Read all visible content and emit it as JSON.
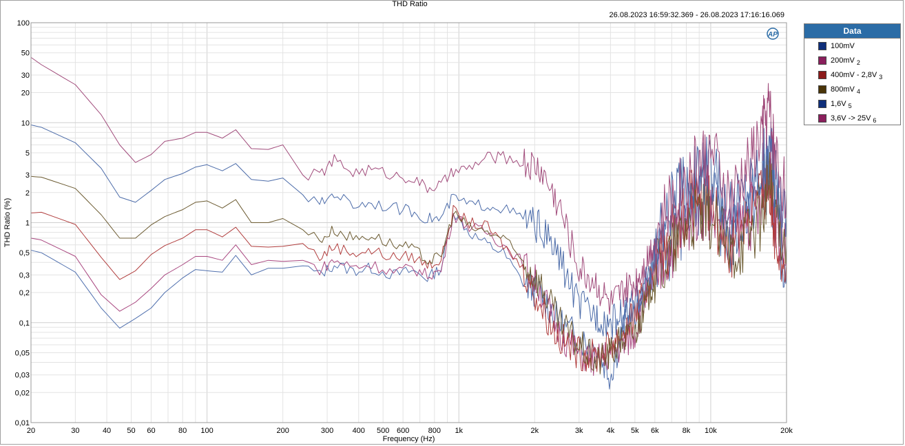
{
  "window": {
    "title": "THD Ratio",
    "timestamp": "26.08.2023 16:59:32.369 - 26.08.2023 17:16:16.069"
  },
  "legend": {
    "header": "Data",
    "items": [
      {
        "label": "100mV",
        "sub": "",
        "color": "#0f2f7a"
      },
      {
        "label": "200mV",
        "sub": "2",
        "color": "#8a1f5c"
      },
      {
        "label": "400mV - 2,8V",
        "sub": "3",
        "color": "#8b1a1a"
      },
      {
        "label": "800mV",
        "sub": "4",
        "color": "#4a3408"
      },
      {
        "label": "1,6V",
        "sub": "5",
        "color": "#0f2f7a"
      },
      {
        "label": "3,6V -> 25V",
        "sub": "6",
        "color": "#8a1f5c"
      }
    ]
  },
  "colors": {
    "grid": "#d9d9d9",
    "series_trace_1": "#4a6aa8",
    "series_trace_2": "#a04a7a",
    "series_trace_3": "#a03a3a",
    "series_trace_4": "#6b5a30"
  },
  "icons": {
    "logo": "ap-logo-icon"
  },
  "chart_data": {
    "type": "line",
    "title": "THD Ratio",
    "xlabel": "Frequency (Hz)",
    "ylabel": "THD Ratio (%)",
    "xscale": "log",
    "yscale": "log",
    "xlim": [
      20,
      20000
    ],
    "ylim": [
      0.01,
      100
    ],
    "grid": true,
    "legend_position": "right",
    "x_ticks": [
      {
        "v": 20,
        "label": "20"
      },
      {
        "v": 30,
        "label": "30"
      },
      {
        "v": 40,
        "label": "40"
      },
      {
        "v": 50,
        "label": "50"
      },
      {
        "v": 60,
        "label": "60"
      },
      {
        "v": 80,
        "label": "80"
      },
      {
        "v": 100,
        "label": "100"
      },
      {
        "v": 200,
        "label": "200"
      },
      {
        "v": 300,
        "label": "300"
      },
      {
        "v": 400,
        "label": "400"
      },
      {
        "v": 500,
        "label": "500"
      },
      {
        "v": 600,
        "label": "600"
      },
      {
        "v": 800,
        "label": "800"
      },
      {
        "v": 1000,
        "label": "1k"
      },
      {
        "v": 2000,
        "label": "2k"
      },
      {
        "v": 3000,
        "label": "3k"
      },
      {
        "v": 4000,
        "label": "4k"
      },
      {
        "v": 5000,
        "label": "5k"
      },
      {
        "v": 6000,
        "label": "6k"
      },
      {
        "v": 8000,
        "label": "8k"
      },
      {
        "v": 10000,
        "label": "10k"
      },
      {
        "v": 20000,
        "label": "20k"
      }
    ],
    "y_ticks": [
      {
        "v": 100,
        "label": "100"
      },
      {
        "v": 50,
        "label": "50"
      },
      {
        "v": 30,
        "label": "30"
      },
      {
        "v": 20,
        "label": "20"
      },
      {
        "v": 10,
        "label": "10"
      },
      {
        "v": 5,
        "label": "5"
      },
      {
        "v": 3,
        "label": "3"
      },
      {
        "v": 2,
        "label": "2"
      },
      {
        "v": 1,
        "label": "1"
      },
      {
        "v": 0.5,
        "label": "0,5"
      },
      {
        "v": 0.3,
        "label": "0,3"
      },
      {
        "v": 0.2,
        "label": "0,2"
      },
      {
        "v": 0.1,
        "label": "0,1"
      },
      {
        "v": 0.05,
        "label": "0,05"
      },
      {
        "v": 0.03,
        "label": "0,03"
      },
      {
        "v": 0.02,
        "label": "0,02"
      },
      {
        "v": 0.01,
        "label": "0,01"
      }
    ],
    "series": [
      {
        "name": "100mV",
        "color": "#5070ae",
        "x": [
          20,
          22,
          30,
          38,
          45,
          52,
          60,
          68,
          80,
          90,
          100,
          115,
          130,
          150,
          175,
          200,
          240,
          280,
          320,
          380,
          450,
          550,
          650,
          750,
          850,
          950,
          1100,
          1300,
          1500,
          1800,
          2100,
          2500,
          3000,
          3500,
          4000,
          4500,
          5000,
          5500,
          6000,
          7000,
          8000,
          9000,
          10000,
          12000,
          14000,
          16000,
          17000,
          18000,
          20000
        ],
        "y": [
          0.53,
          0.5,
          0.32,
          0.14,
          0.088,
          0.11,
          0.14,
          0.2,
          0.28,
          0.34,
          0.33,
          0.32,
          0.47,
          0.3,
          0.35,
          0.35,
          0.37,
          0.3,
          0.38,
          0.33,
          0.35,
          0.3,
          0.33,
          0.28,
          0.35,
          1.3,
          0.8,
          0.6,
          0.5,
          0.25,
          0.2,
          0.1,
          0.07,
          0.055,
          0.03,
          0.09,
          0.12,
          0.22,
          0.35,
          0.6,
          1.2,
          1.6,
          1.8,
          0.6,
          1.5,
          2.0,
          3.0,
          1.0,
          0.3
        ]
      },
      {
        "name": "200mV",
        "color": "#a8467f",
        "x": [
          20,
          22,
          30,
          38,
          45,
          52,
          60,
          68,
          80,
          90,
          100,
          115,
          130,
          150,
          175,
          200,
          240,
          280,
          320,
          380,
          450,
          550,
          650,
          750,
          850,
          950,
          1100,
          1300,
          1500,
          1800,
          2100,
          2500,
          3000,
          3500,
          4000,
          4500,
          5000,
          5500,
          6000,
          7000,
          8000,
          9000,
          10000,
          12000,
          14000,
          16000,
          17000,
          18000,
          20000
        ],
        "y": [
          0.7,
          0.67,
          0.46,
          0.19,
          0.13,
          0.16,
          0.22,
          0.3,
          0.38,
          0.46,
          0.46,
          0.42,
          0.6,
          0.38,
          0.42,
          0.41,
          0.42,
          0.34,
          0.42,
          0.36,
          0.38,
          0.32,
          0.35,
          0.3,
          0.33,
          1.2,
          0.9,
          0.8,
          0.6,
          0.4,
          0.22,
          0.08,
          0.05,
          0.04,
          0.05,
          0.06,
          0.08,
          0.18,
          0.3,
          0.6,
          1.0,
          1.5,
          1.4,
          0.7,
          1.1,
          1.4,
          5.0,
          1.2,
          0.5
        ]
      },
      {
        "name": "400mV - 2,8V",
        "color": "#b03c3c",
        "x": [
          20,
          22,
          30,
          38,
          45,
          52,
          60,
          68,
          80,
          90,
          100,
          115,
          130,
          150,
          175,
          200,
          240,
          280,
          320,
          380,
          450,
          550,
          650,
          750,
          850,
          950,
          1100,
          1300,
          1500,
          1800,
          2100,
          2500,
          3000,
          3500,
          4000,
          4500,
          5000,
          5500,
          6000,
          7000,
          8000,
          9000,
          10000,
          12000,
          14000,
          16000,
          17000,
          18000,
          20000
        ],
        "y": [
          1.25,
          1.27,
          0.96,
          0.45,
          0.27,
          0.33,
          0.48,
          0.59,
          0.7,
          0.85,
          0.85,
          0.72,
          0.9,
          0.58,
          0.57,
          0.58,
          0.62,
          0.45,
          0.58,
          0.5,
          0.52,
          0.45,
          0.46,
          0.38,
          0.42,
          1.3,
          1.0,
          0.9,
          0.6,
          0.35,
          0.15,
          0.07,
          0.05,
          0.045,
          0.06,
          0.08,
          0.12,
          0.2,
          0.35,
          0.7,
          1.4,
          2.0,
          1.3,
          0.6,
          1.4,
          1.8,
          2.5,
          0.9,
          0.4
        ]
      },
      {
        "name": "800mV",
        "color": "#6b5a30",
        "x": [
          20,
          22,
          30,
          38,
          45,
          52,
          60,
          68,
          80,
          90,
          100,
          115,
          130,
          150,
          175,
          200,
          240,
          280,
          320,
          380,
          450,
          550,
          650,
          750,
          850,
          950,
          1100,
          1300,
          1500,
          1800,
          2100,
          2500,
          3000,
          3500,
          4000,
          4500,
          5000,
          5500,
          6000,
          7000,
          8000,
          9000,
          10000,
          12000,
          14000,
          16000,
          17000,
          18000,
          20000
        ],
        "y": [
          2.9,
          2.85,
          2.2,
          1.2,
          0.7,
          0.7,
          0.95,
          1.15,
          1.35,
          1.6,
          1.65,
          1.4,
          1.7,
          1.0,
          1.0,
          1.1,
          0.85,
          0.68,
          0.85,
          0.7,
          0.75,
          0.6,
          0.55,
          0.42,
          0.45,
          1.25,
          0.9,
          0.8,
          0.7,
          0.4,
          0.25,
          0.1,
          0.06,
          0.04,
          0.05,
          0.07,
          0.08,
          0.15,
          0.3,
          0.5,
          1.0,
          1.2,
          1.1,
          0.5,
          0.8,
          1.2,
          2.8,
          1.5,
          0.6
        ]
      },
      {
        "name": "1,6V",
        "color": "#4a6aa8",
        "x": [
          20,
          22,
          30,
          38,
          45,
          52,
          60,
          68,
          80,
          90,
          100,
          115,
          130,
          150,
          175,
          200,
          240,
          280,
          320,
          380,
          450,
          550,
          650,
          750,
          850,
          950,
          1100,
          1300,
          1500,
          1800,
          2100,
          2500,
          3000,
          3500,
          4000,
          4500,
          5000,
          5500,
          6000,
          7000,
          8000,
          9000,
          10000,
          12000,
          14000,
          16000,
          17000,
          18000,
          20000
        ],
        "y": [
          9.5,
          9.0,
          6.3,
          3.5,
          1.8,
          1.6,
          2.1,
          2.7,
          3.1,
          3.6,
          3.8,
          3.3,
          3.9,
          2.7,
          2.6,
          2.8,
          1.9,
          1.5,
          2.0,
          1.5,
          1.6,
          1.4,
          1.3,
          1.1,
          1.1,
          1.8,
          1.5,
          1.5,
          1.4,
          1.1,
          0.9,
          0.45,
          0.15,
          0.12,
          0.1,
          0.12,
          0.15,
          0.25,
          0.5,
          1.5,
          2.5,
          3.0,
          3.5,
          1.2,
          2.5,
          4.0,
          6.0,
          3.0,
          1.2
        ]
      },
      {
        "name": "3,6V -> 25V",
        "color": "#a04a7a",
        "x": [
          20,
          22,
          30,
          38,
          45,
          52,
          60,
          68,
          80,
          90,
          100,
          115,
          130,
          150,
          175,
          200,
          240,
          280,
          320,
          380,
          450,
          550,
          650,
          750,
          850,
          950,
          1100,
          1300,
          1500,
          1800,
          2100,
          2500,
          3000,
          3500,
          4000,
          4500,
          5000,
          5500,
          6000,
          7000,
          8000,
          9000,
          10000,
          12000,
          14000,
          16000,
          17000,
          18000,
          20000
        ],
        "y": [
          45,
          38,
          24,
          12,
          6.0,
          4.0,
          4.8,
          6.5,
          7.0,
          8.0,
          8.0,
          7.0,
          8.5,
          5.5,
          5.4,
          6.0,
          3.0,
          3.0,
          4.2,
          3.2,
          3.4,
          3.0,
          2.8,
          2.2,
          2.4,
          3.2,
          3.5,
          4.5,
          4.5,
          4.0,
          3.5,
          1.5,
          0.35,
          0.25,
          0.15,
          0.2,
          0.25,
          0.4,
          0.7,
          1.6,
          3.0,
          4.0,
          5.0,
          1.6,
          3.5,
          8.0,
          15.0,
          5.0,
          2.0
        ]
      }
    ]
  }
}
